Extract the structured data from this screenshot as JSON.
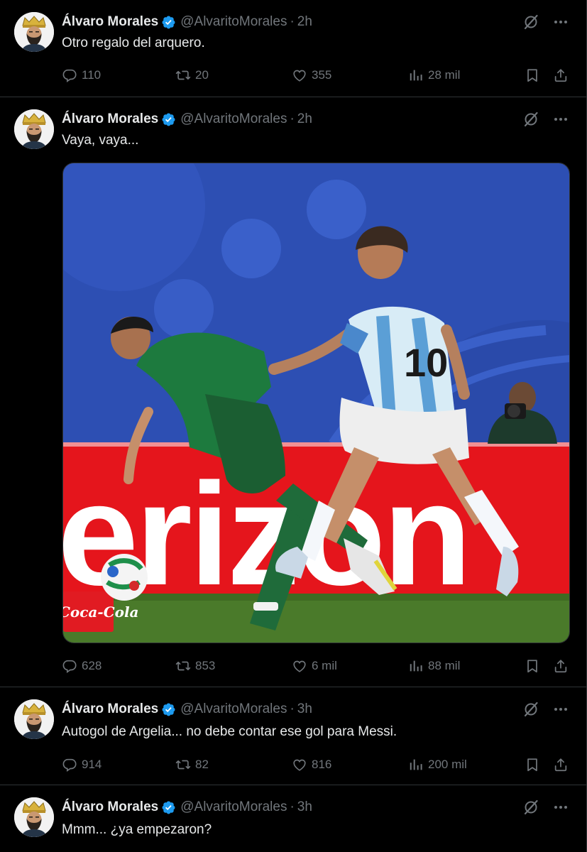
{
  "author": {
    "name": "Álvaro Morales",
    "handle": "@AlvaritoMorales",
    "separator": "·"
  },
  "tweets": [
    {
      "time": "2h",
      "text": "Otro regalo del arquero.",
      "stats": {
        "replies": "110",
        "reposts": "20",
        "likes": "355",
        "views": "28 mil"
      }
    },
    {
      "time": "2h",
      "text": "Vaya, vaya...",
      "media": {
        "banner_text": "erizon",
        "sponsor_text": "Coca-Cola",
        "jersey_number": "10"
      },
      "stats": {
        "replies": "628",
        "reposts": "853",
        "likes": "6 mil",
        "views": "88 mil"
      }
    },
    {
      "time": "3h",
      "text": "Autogol de Argelia... no debe contar ese gol para Messi.",
      "stats": {
        "replies": "914",
        "reposts": "82",
        "likes": "816",
        "views": "200 mil"
      }
    },
    {
      "time": "3h",
      "text": "Mmm... ¿ya empezaron?"
    }
  ],
  "icons": {
    "verified": "verified-badge-icon",
    "grok": "grok-icon",
    "more": "more-icon",
    "reply": "reply-icon",
    "repost": "repost-icon",
    "like": "like-icon",
    "views": "views-icon",
    "bookmark": "bookmark-icon",
    "share": "share-icon"
  },
  "colors": {
    "background": "#000000",
    "text": "#e7e9ea",
    "muted": "#71767b",
    "divider": "#2f3336",
    "verified": "#1d9bf0"
  }
}
